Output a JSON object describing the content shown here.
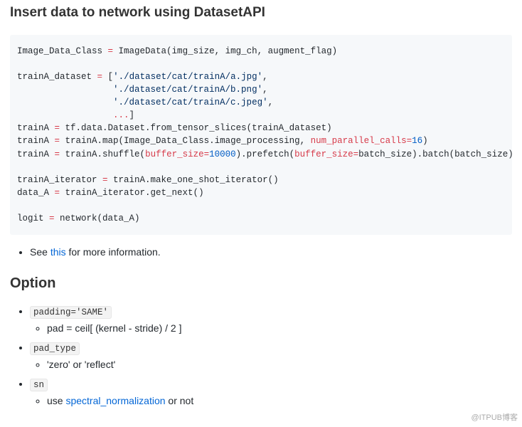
{
  "heading1": "Insert data to network using DatasetAPI",
  "code": {
    "l1a": "Image_Data_Class ",
    "l1b": "=",
    "l1c": " ImageData(img_size, img_ch, augment_flag)",
    "l2a": "trainA_dataset ",
    "l2b": "=",
    "l2c": " [",
    "l2d": "'./dataset/cat/trainA/a.jpg'",
    "l2e": ",",
    "l3pad": "                  ",
    "l3a": "'./dataset/cat/trainA/b.png'",
    "l3b": ",",
    "l4a": "'./dataset/cat/trainA/c.jpeg'",
    "l4b": ",",
    "l5a": "...",
    "l5b": "]",
    "l6a": "trainA ",
    "l6b": "=",
    "l6c": " tf.data.Dataset.from_tensor_slices(trainA_dataset)",
    "l7a": "trainA ",
    "l7b": "=",
    "l7c": " trainA.map(Image_Data_Class.image_processing, ",
    "l7d": "num_parallel_calls",
    "l7e": "=",
    "l7f": "16",
    "l7g": ")",
    "l8a": "trainA ",
    "l8b": "=",
    "l8c": " trainA.shuffle(",
    "l8d": "buffer_size",
    "l8e": "=",
    "l8f": "10000",
    "l8g": ").prefetch(",
    "l8h": "buffer_size",
    "l8i": "=",
    "l8j": "batch_size).batch(batch_size).repeat()",
    "l9a": "trainA_iterator ",
    "l9b": "=",
    "l9c": " trainA.make_one_shot_iterator()",
    "l10a": "data_A ",
    "l10b": "=",
    "l10c": " trainA_iterator.get_next()",
    "l11a": "logit ",
    "l11b": "=",
    "l11c": " network(data_A)"
  },
  "note": {
    "prefix": "See ",
    "link": "this",
    "suffix": " for more information."
  },
  "heading2": "Option",
  "options": {
    "o1_code": "padding='SAME'",
    "o1_sub": "pad = ceil[ (kernel - stride) / 2 ]",
    "o2_code": "pad_type",
    "o2_sub": "'zero' or 'reflect'",
    "o3_code": "sn",
    "o3_sub_a": "use ",
    "o3_link": "spectral_normalization",
    "o3_sub_b": " or not"
  },
  "watermark": "@ITPUB博客"
}
